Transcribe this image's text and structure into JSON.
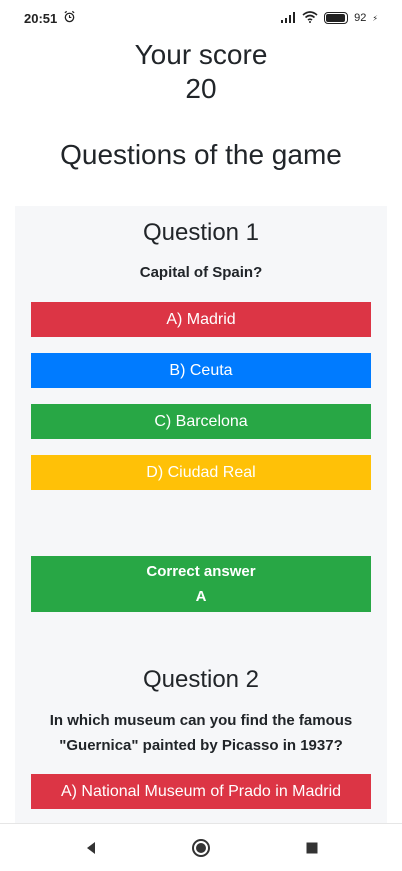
{
  "status_bar": {
    "time": "20:51",
    "alarm_icon": "alarm-clock-icon",
    "signal_icon": "cell-signal-icon",
    "wifi_icon": "wifi-icon",
    "battery_level": "92",
    "battery_extra": "⚡"
  },
  "score": {
    "title": "Your score",
    "value": "20"
  },
  "questions_heading": "Questions of the game",
  "question1": {
    "title": "Question 1",
    "text": "Capital of Spain?",
    "options": [
      "A) Madrid",
      "B) Ceuta",
      "C) Barcelona",
      "D) Ciudad Real"
    ],
    "correct_label": "Correct answer",
    "correct_value": "A"
  },
  "question2": {
    "title": "Question 2",
    "text": "In which museum can you find the famous \"Guernica\" painted by Picasso in 1937?",
    "options": [
      "A) National Museum of Prado in Madrid"
    ]
  },
  "colors": {
    "option_a": "#dc3545",
    "option_b": "#007bff",
    "option_c": "#28a745",
    "option_d": "#ffc107",
    "panel_bg": "#f6f7f9"
  },
  "nav": {
    "back_icon": "back-triangle-icon",
    "home_icon": "home-circle-icon",
    "recents_icon": "recents-square-icon"
  }
}
